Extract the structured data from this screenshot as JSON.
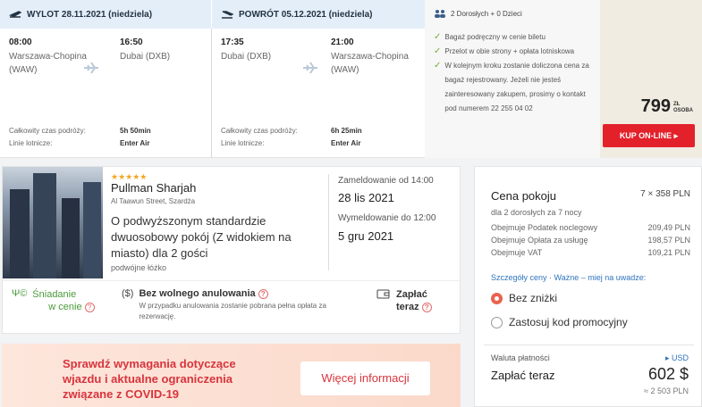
{
  "outbound": {
    "header": "WYLOT 28.11.2021 (niedziela)",
    "dep_time": "08:00",
    "dep_place": "Warszawa-Chopina",
    "dep_code": "(WAW)",
    "arr_time": "16:50",
    "arr_place": "Dubai (DXB)",
    "duration_label": "Całkowity czas podróży:",
    "duration": "5h 50min",
    "airline_label": "Linie lotnicze:",
    "airline": "Enter Air"
  },
  "inbound": {
    "header": "POWRÓT 05.12.2021 (niedziela)",
    "dep_time": "17:35",
    "dep_place": "Dubai (DXB)",
    "arr_time": "21:00",
    "arr_place": "Warszawa-Chopina",
    "arr_code": "(WAW)",
    "duration_label": "Całkowity czas podróży:",
    "duration": "6h 25min",
    "airline_label": "Linie lotnicze:",
    "airline": "Enter Air"
  },
  "info": {
    "passengers": "2 Dorosłych + 0 Dzieci",
    "items": [
      "Bagaż podręczny w cenie biletu",
      "Przelot w obie strony + opłata lotniskowa",
      "W kolejnym kroku zostanie doliczona cena za bagaż rejestrowany. Jeżeli nie jesteś zainteresowany zakupem, prosimy o kontakt pod numerem 22 255 04 02"
    ]
  },
  "price": {
    "value": "799",
    "unit_top": "ZŁ",
    "unit_bottom": "OSOBA",
    "buy": "KUP ON-LINE ▸"
  },
  "hotel": {
    "stars": "★★★★★",
    "name": "Pullman Sharjah",
    "address": "Al Taawun Street, Szardża",
    "room": "O podwyższonym standardzie dwuosobowy pokój (Z widokiem na miasto) dla 2 gości",
    "bed": "podwójne łóżko",
    "checkin_label": "Zameldowanie od 14:00",
    "checkin_date": "28 lis 2021",
    "checkout_label": "Wymeldowanie do 12:00",
    "checkout_date": "5 gru 2021",
    "breakfast_l1": "Śniadanie",
    "breakfast_l2": "w cenie",
    "cancel_title": "Bez wolnego anulowania",
    "cancel_text": "W przypadku anulowania zostanie pobrana pełna opłata za rezerwację.",
    "pay_l1": "Zapłać",
    "pay_l2": "teraz"
  },
  "covid": {
    "text": "Sprawdź wymagania dotyczące wjazdu i aktualne ograniczenia związane z COVID-19",
    "button": "Więcej informacji"
  },
  "summary": {
    "title": "Cena pokoju",
    "title_value": "7 × 358 PLN",
    "sub": "dla 2 dorosłych  za 7 nocy",
    "rows": [
      {
        "label": "Obejmuje Podatek noclegowy",
        "value": "209,49 PLN"
      },
      {
        "label": "Obejmuje Opłata za usługę",
        "value": "198,57 PLN"
      },
      {
        "label": "Obejmuje VAT",
        "value": "109,21 PLN"
      }
    ],
    "details_link": "Szczegóły ceny",
    "note_link": "Ważne – miej na uwadze:",
    "opt1": "Bez zniżki",
    "opt2": "Zastosuj kod promocyjny",
    "currency_label": "Waluta płatności",
    "currency": "▸ USD",
    "pay_label": "Zapłać teraz",
    "pay_value": "602 $",
    "pay_pln": "≈ 2 503 PLN"
  }
}
